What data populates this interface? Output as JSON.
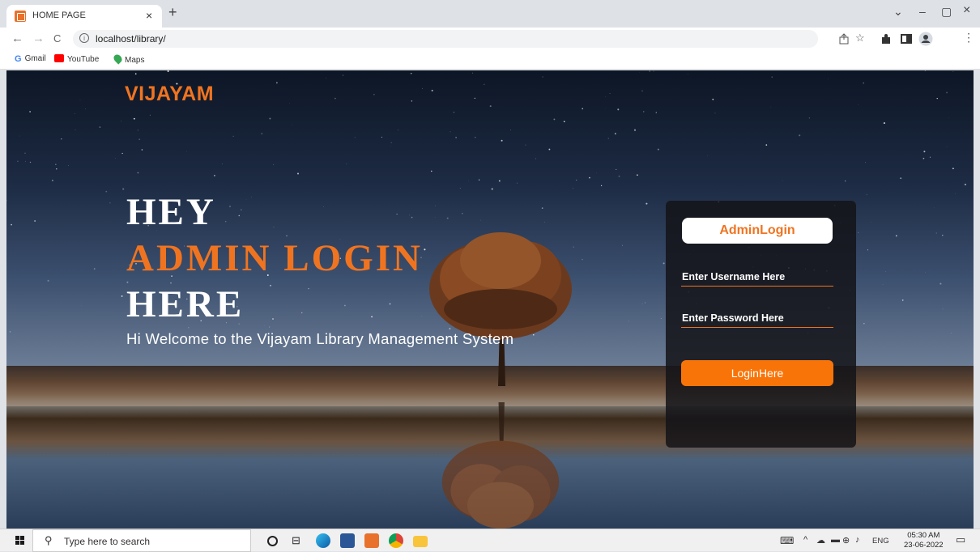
{
  "browser": {
    "tab_title": "HOME PAGE",
    "tab_close": "×",
    "new_tab": "+",
    "window_controls": {
      "collapse": "⌄",
      "minimize": "–",
      "maximize": "▢",
      "close": "×"
    },
    "nav": {
      "back": "←",
      "forward": "→",
      "reload": "C"
    },
    "url": "localhost/library/",
    "toolbar_icons": [
      "share-icon",
      "star-icon",
      "extensions-icon",
      "sidepanel-icon",
      "profile-icon",
      "menu-icon"
    ]
  },
  "bookmarks": [
    {
      "label": "Gmail",
      "icon": "google-icon",
      "color": "#4285f4"
    },
    {
      "label": "YouTube",
      "icon": "youtube-icon",
      "color": "#ff0000"
    },
    {
      "label": "Maps",
      "icon": "maps-icon",
      "color": "#34a853"
    }
  ],
  "page": {
    "logo": "VIJAYAM",
    "hero": {
      "line1": "HEY",
      "line2": "ADMIN LOGIN",
      "line3": "HERE"
    },
    "welcome": "Hi Welcome to the Vijayam Library Management System",
    "login": {
      "title": "AdminLogin",
      "username_placeholder": "Enter Username Here",
      "password_placeholder": "Enter Password Here",
      "button": "LoginHere"
    },
    "colors": {
      "accent": "#f07420",
      "button": "#f97408"
    }
  },
  "taskbar": {
    "search_placeholder": "Type here to search",
    "pinned": [
      "cortana-icon",
      "task-view-icon",
      "edge-icon",
      "word-icon",
      "xampp-icon",
      "chrome-icon",
      "file-explorer-icon"
    ],
    "language": "ENG",
    "time": "05:30 AM",
    "date": "23-06-2022"
  }
}
